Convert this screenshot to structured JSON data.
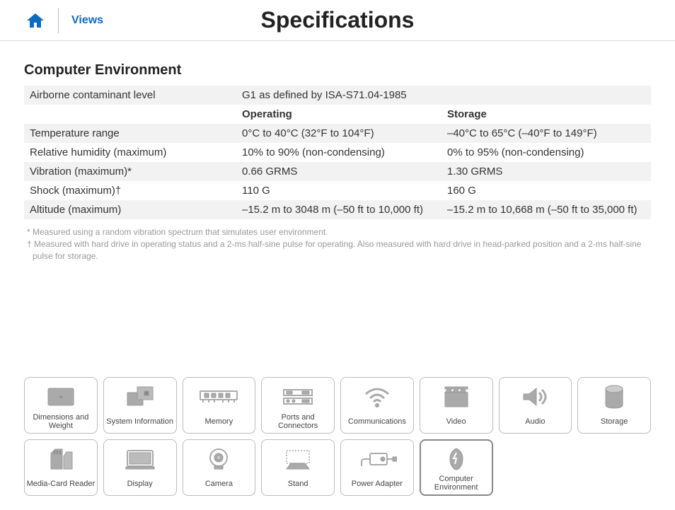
{
  "header": {
    "views_link": "Views",
    "page_title": "Specifications"
  },
  "section": {
    "heading": "Computer Environment",
    "column_headers": {
      "operating": "Operating",
      "storage": "Storage"
    },
    "airborne_row": {
      "label": "Airborne contaminant level",
      "value": "G1 as defined by ISA-S71.04-1985"
    },
    "rows": [
      {
        "label": "Temperature range",
        "operating": "0°C to 40°C (32°F to 104°F)",
        "storage": "–40°C to 65°C (–40°F to 149°F)"
      },
      {
        "label": "Relative humidity (maximum)",
        "operating": "10% to 90% (non-condensing)",
        "storage": "0% to 95% (non-condensing)"
      },
      {
        "label": "Vibration (maximum)*",
        "operating": "0.66 GRMS",
        "storage": "1.30 GRMS"
      },
      {
        "label": "Shock (maximum)†",
        "operating": "110 G",
        "storage": "160 G"
      },
      {
        "label": "Altitude (maximum)",
        "operating": "–15.2 m to 3048 m (–50 ft to 10,000 ft)",
        "storage": "–15.2 m to 10,668 m (–50 ft to 35,000 ft)"
      }
    ],
    "footnotes": [
      "* Measured using a random vibration spectrum that simulates user environment.",
      "† Measured with hard drive in operating status and a 2-ms half-sine pulse for operating. Also measured with hard drive in head-parked position and a 2-ms half-sine pulse for storage."
    ]
  },
  "nav": [
    {
      "label": "Dimensions and Weight",
      "active": false
    },
    {
      "label": "System Information",
      "active": false
    },
    {
      "label": "Memory",
      "active": false
    },
    {
      "label": "Ports and Connectors",
      "active": false
    },
    {
      "label": "Communications",
      "active": false
    },
    {
      "label": "Video",
      "active": false
    },
    {
      "label": "Audio",
      "active": false
    },
    {
      "label": "Storage",
      "active": false
    },
    {
      "label": "Media-Card Reader",
      "active": false
    },
    {
      "label": "Display",
      "active": false
    },
    {
      "label": "Camera",
      "active": false
    },
    {
      "label": "Stand",
      "active": false
    },
    {
      "label": "Power Adapter",
      "active": false
    },
    {
      "label": "Computer Environment",
      "active": true
    }
  ]
}
